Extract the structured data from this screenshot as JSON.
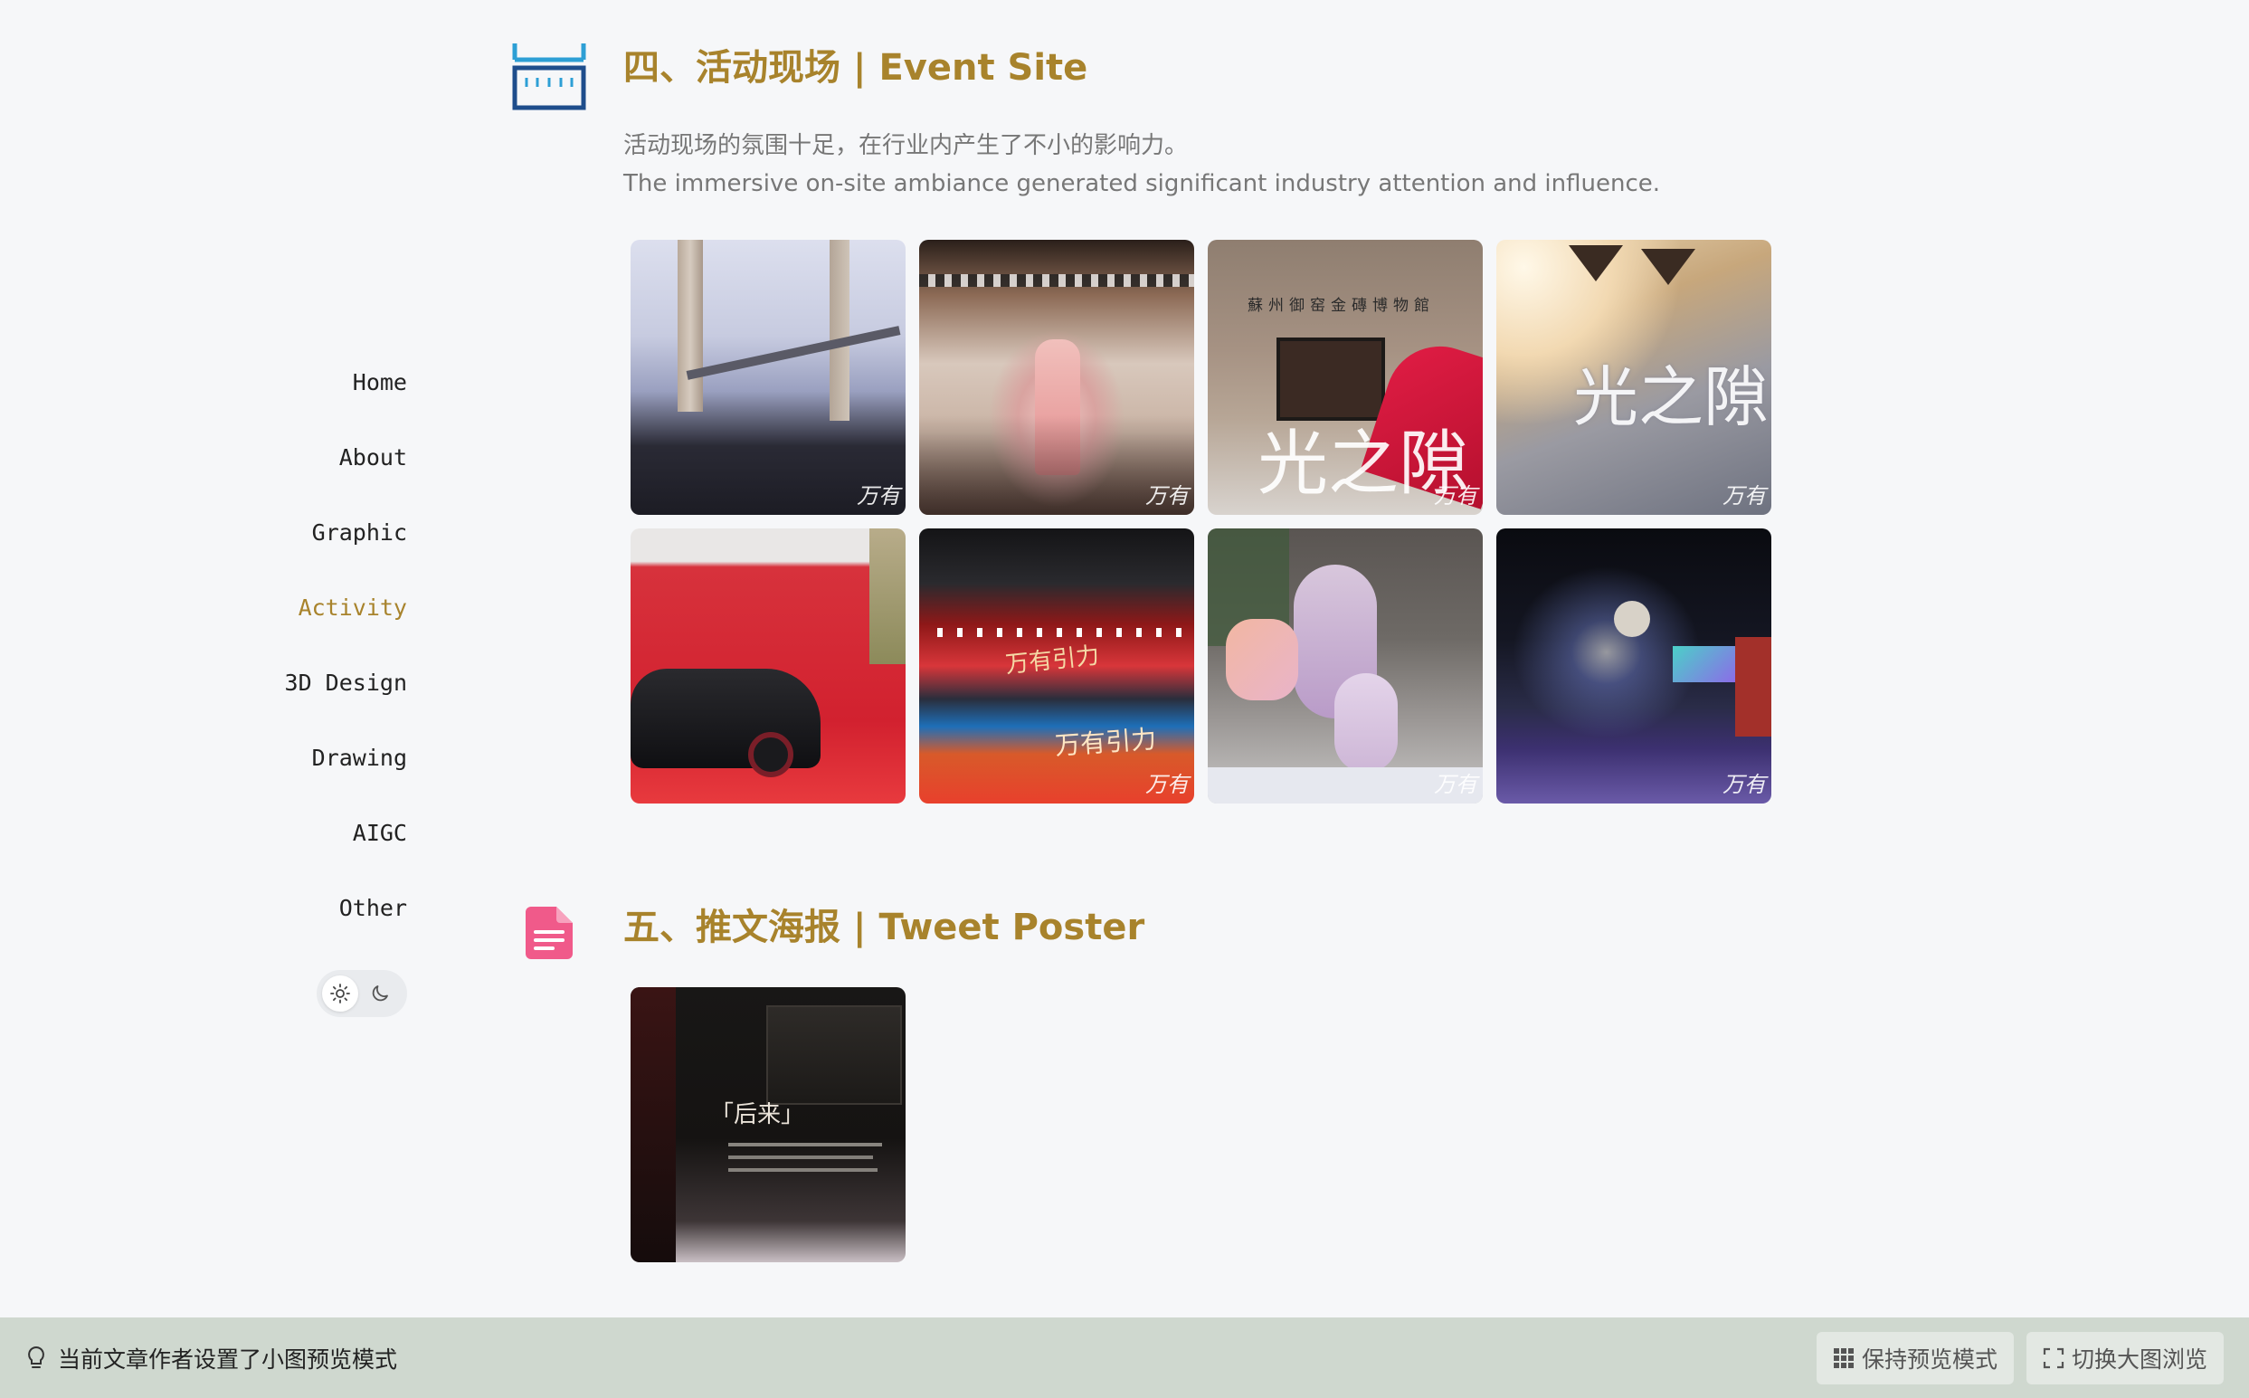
{
  "nav": {
    "items": [
      "Home",
      "About",
      "Graphic",
      "Activity",
      "3D Design",
      "Drawing",
      "AIGC",
      "Other"
    ],
    "active": "Activity"
  },
  "theme": {
    "light_icon": "sun-icon",
    "dark_icon": "moon-icon",
    "selected": "light"
  },
  "sections": {
    "event": {
      "title": "四、活动现场 | Event Site",
      "icon": "ruler-icon",
      "desc_cn": "活动现场的氛围十足，在行业内产生了不小的影响力。",
      "desc_en": "The immersive on-site ambiance generated significant industry attention and influence.",
      "photo_texts": {
        "museum_sign": "蘇州御窑金磚博物館",
        "light_text": "光之隙",
        "stage_text": "万有引力",
        "watermark": "万有"
      }
    },
    "tweet": {
      "title": "五、推文海报 | Tweet Poster",
      "icon": "document-icon",
      "poster_heading": "「后来」"
    }
  },
  "bottom_bar": {
    "hint": "当前文章作者设置了小图预览模式",
    "keep_preview": "保持预览模式",
    "switch_large": "切换大图浏览"
  },
  "colors": {
    "accent": "#a8832c",
    "background": "#f6f7f9",
    "bar_bg": "#cfd8cf",
    "event_icon": "#2d8fd5",
    "tweet_icon": "#f05a8a"
  }
}
